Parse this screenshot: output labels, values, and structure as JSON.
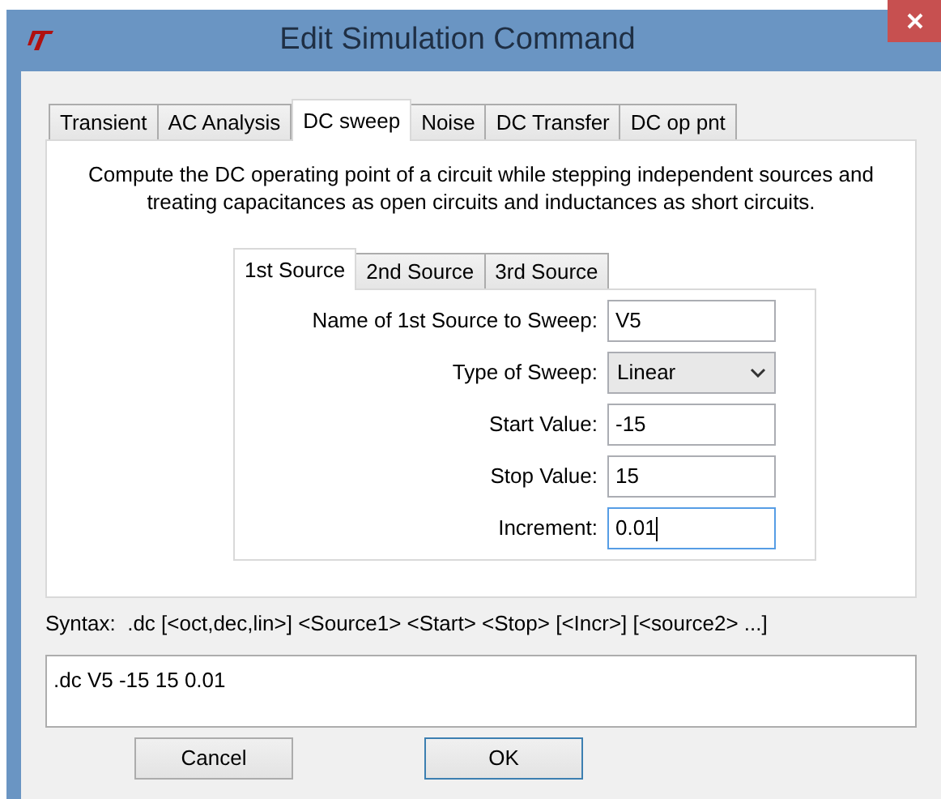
{
  "window": {
    "title": "Edit Simulation Command"
  },
  "tabs": [
    {
      "label": "Transient",
      "selected": false
    },
    {
      "label": "AC Analysis",
      "selected": false
    },
    {
      "label": "DC sweep",
      "selected": true
    },
    {
      "label": "Noise",
      "selected": false
    },
    {
      "label": "DC Transfer",
      "selected": false
    },
    {
      "label": "DC op pnt",
      "selected": false
    }
  ],
  "description": "Compute the DC operating point of a circuit while stepping independent sources and treating capacitances as open circuits and inductances as short circuits.",
  "source_tabs": [
    {
      "label": "1st Source",
      "selected": true
    },
    {
      "label": "2nd Source",
      "selected": false
    },
    {
      "label": "3rd Source",
      "selected": false
    }
  ],
  "fields": [
    {
      "kind": "text",
      "label": "Name of 1st Source to Sweep:",
      "value": "V5",
      "focused": false
    },
    {
      "kind": "dropdown",
      "label": "Type of Sweep:",
      "value": "Linear",
      "focused": false
    },
    {
      "kind": "text",
      "label": "Start Value:",
      "value": "-15",
      "focused": false
    },
    {
      "kind": "text",
      "label": "Stop Value:",
      "value": "15",
      "focused": false
    },
    {
      "kind": "text",
      "label": "Increment:",
      "value": "0.01",
      "focused": true
    }
  ],
  "syntax": "Syntax:  .dc [<oct,dec,lin>] <Source1> <Start> <Stop> [<Incr>] [<source2> ...]",
  "command": ".dc V5 -15 15 0.01",
  "buttons": [
    {
      "label": "Cancel",
      "default": false
    },
    {
      "label": "OK",
      "default": true
    }
  ]
}
